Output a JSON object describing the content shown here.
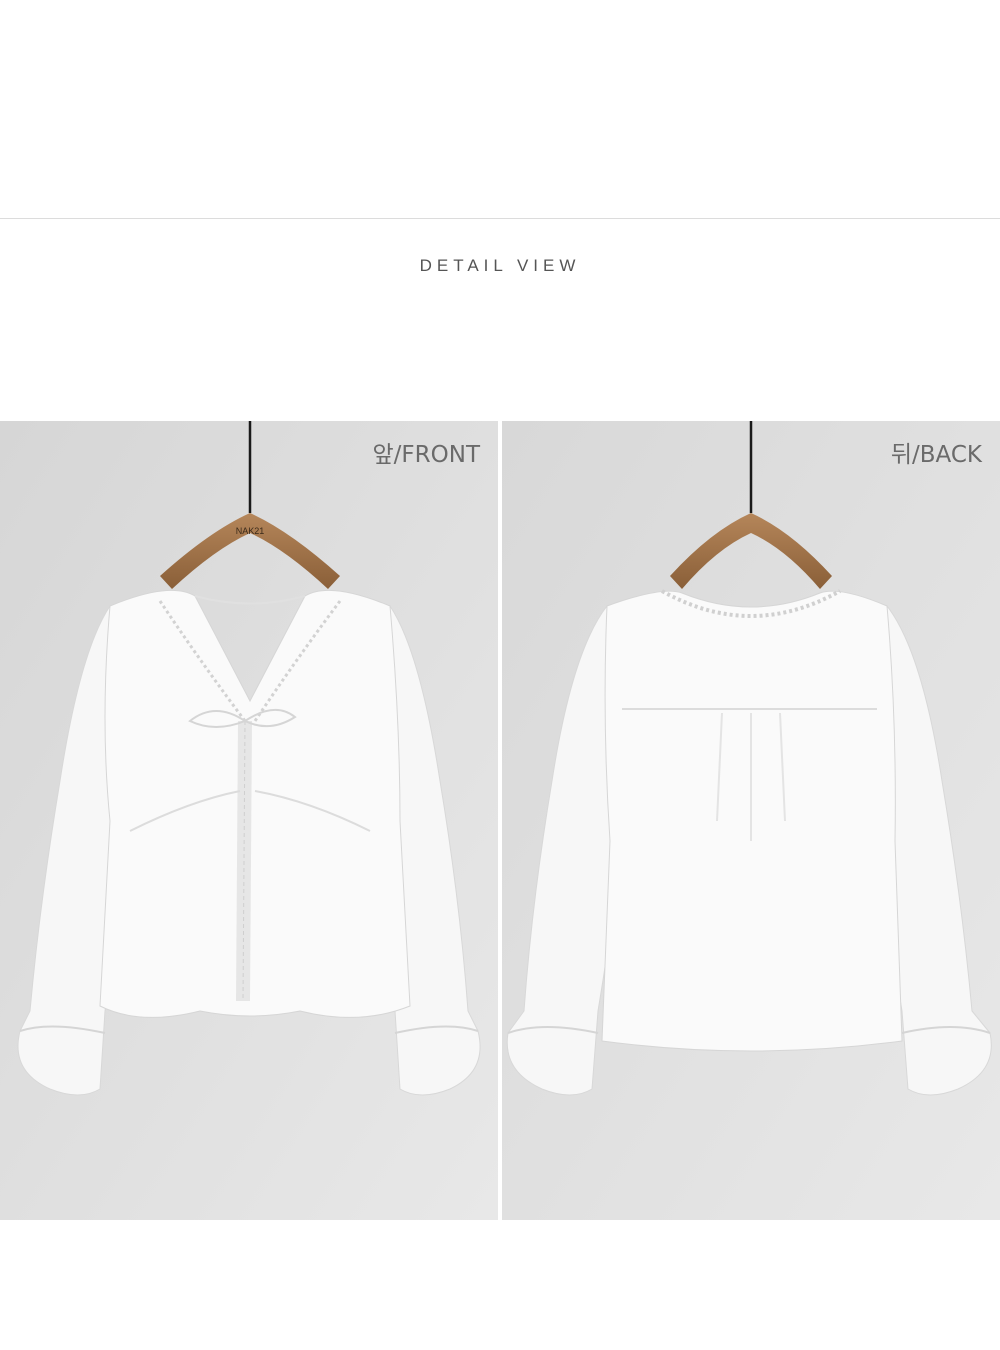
{
  "section": {
    "title": "DETAIL VIEW"
  },
  "photos": [
    {
      "caption": "앞/FRONT",
      "hanger_brand": "NAK21"
    },
    {
      "caption": "뒤/BACK"
    }
  ],
  "colors": {
    "background": "#e2e2e2",
    "garment": "#ffffff",
    "hanger": "#a0744a"
  }
}
